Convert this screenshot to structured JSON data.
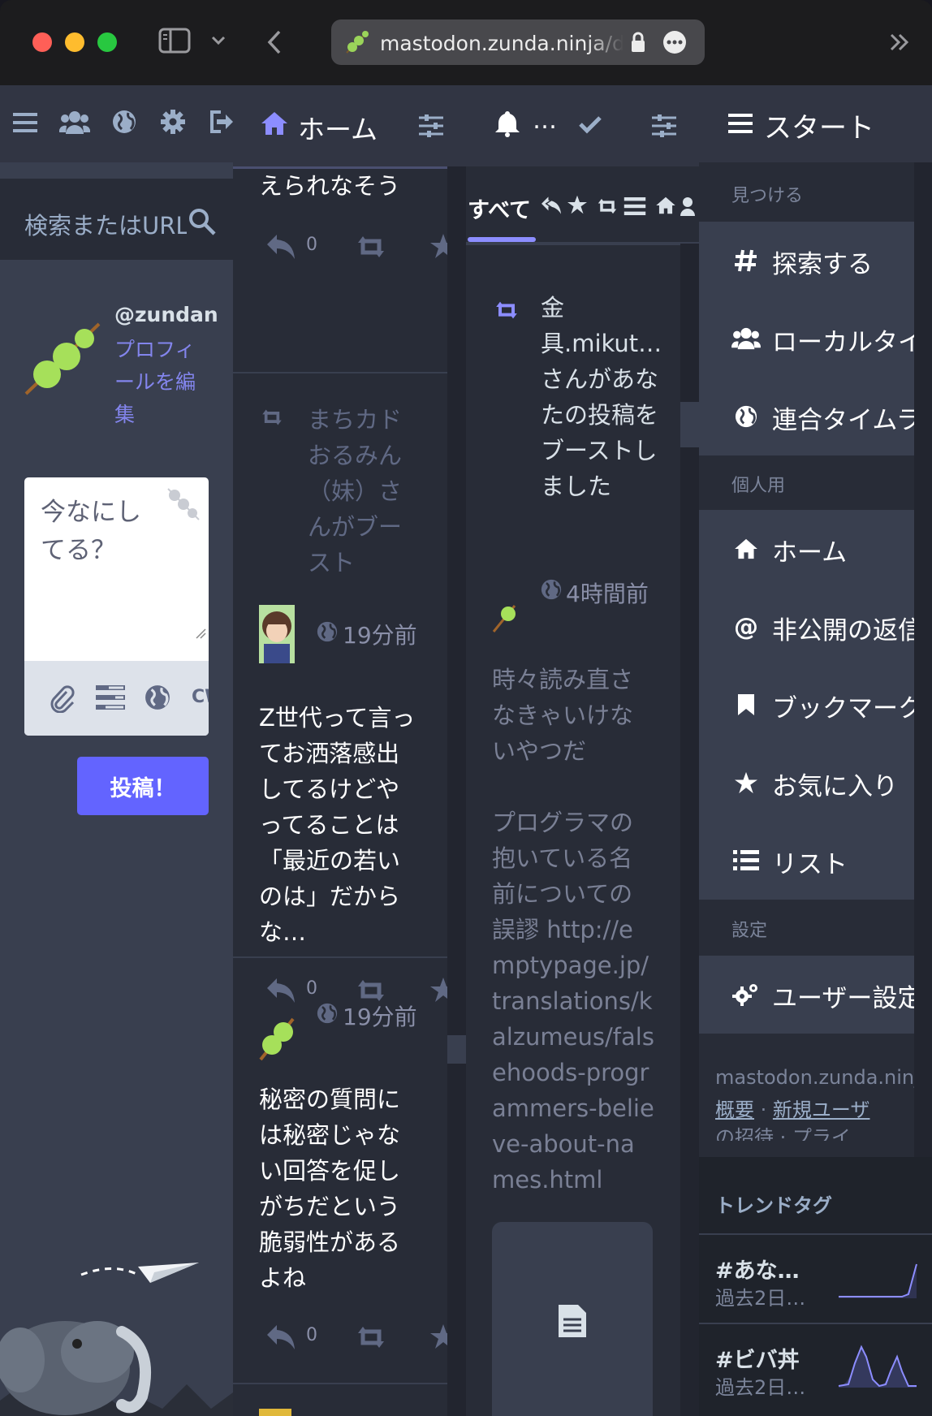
{
  "browser": {
    "url": "mastodon.zunda.ninja/d"
  },
  "compose": {
    "search_placeholder": "検索またはURL",
    "account_handle": "@zundan",
    "edit_profile": "プロフィールを編集",
    "textarea_placeholder": "今なにしてる？",
    "cw_label": "CW",
    "post_button": "投稿！"
  },
  "home": {
    "title": "ホーム",
    "statuses": [
      {
        "text": "えられなそう",
        "reply_count": "0"
      },
      {
        "boosted_by": "まちカドおるみん（妹）さんがブースト",
        "time": "19分前",
        "text": "Z世代って言ってお洒落感出してるけどやってることは「最近の若いのは」だからな…",
        "reply_count": "0"
      },
      {
        "time": "19分前",
        "text": "秘密の質問には秘密じゃない回答を促しがちだという脆弱性があるよね",
        "reply_count": "0"
      }
    ]
  },
  "notifications": {
    "title": "…",
    "filter_all": "すべて",
    "notice": "金具.mikut…さんがあなたの投稿をブーストしました",
    "time": "4時間前",
    "text": "時々読み直さなきゃいけないやつだ\n\nプログラマの抱いている名前についての誤謬 http://emptypage.jp/translations/kalzumeus/falsehoods-programmers-believe-about-names.html"
  },
  "start": {
    "title": "スタート",
    "sections": {
      "discover": "見つける",
      "personal": "個人用",
      "settings": "設定"
    },
    "discover_items": [
      "探索する",
      "ローカルタイムライン",
      "連合タイムライン"
    ],
    "personal_items": [
      "ホーム",
      "非公開の返信",
      "ブックマーク",
      "お気に入り",
      "リスト"
    ],
    "settings_items": [
      "ユーザー設定"
    ],
    "footer_domain": "mastodon.zunda.ninja",
    "footer_about": "概要",
    "footer_sep": "·",
    "footer_signup": "新規ユーザ",
    "footer_more": "の招待 · プライ",
    "trends_title": "トレンドタグ",
    "trends": [
      {
        "tag": "#あな…",
        "sub": "過去2日…"
      },
      {
        "tag": "#ビバ丼",
        "sub": "過去2日…"
      }
    ]
  },
  "colors": {
    "accent": "#6364ff",
    "bg_dark": "#282c37",
    "bg_header": "#313543",
    "bg_compose": "#393f4f"
  }
}
